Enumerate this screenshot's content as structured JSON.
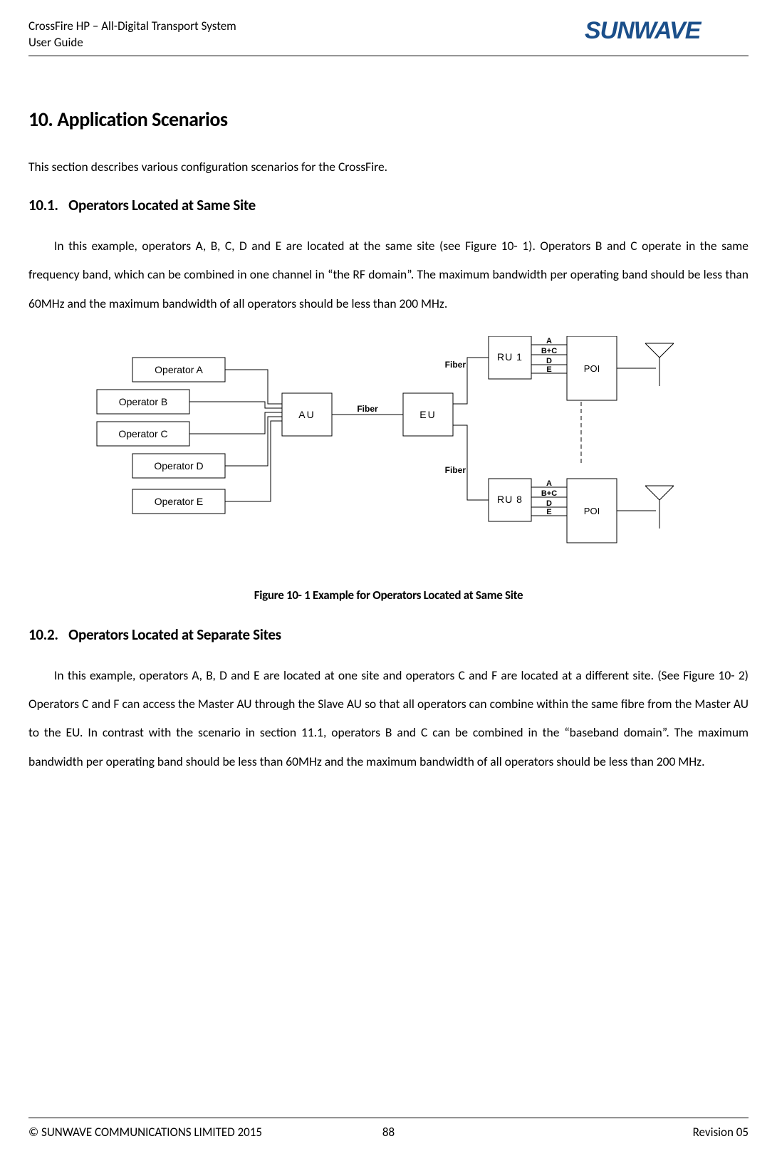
{
  "header": {
    "title_line1": "CrossFire HP – All-Digital Transport System",
    "title_line2": "User Guide",
    "logo_text": "SUNWAVE"
  },
  "section": {
    "number": "10.",
    "title": "Application Scenarios",
    "intro": "This section describes various configuration scenarios for the CrossFire."
  },
  "sub1": {
    "number": "10.1.",
    "title": "Operators Located at Same Site",
    "para": "In this example, operators A, B, C, D and E are located at the same site (see Figure 10- 1). Operators B and C operate in the same frequency band, which can be combined in one channel in “the RF domain”. The maximum bandwidth per operating band should be less than 60MHz and the maximum bandwidth of all operators should be less than 200 MHz."
  },
  "figure": {
    "caption": "Figure 10- 1 Example for Operators Located at Same Site",
    "operators": [
      "Operator A",
      "Operator B",
      "Operator C",
      "Operator D",
      "Operator E"
    ],
    "au": "AU",
    "eu": "EU",
    "fiber": "Fiber",
    "ru1": "RU 1",
    "ru8": "RU 8",
    "poi": "POI",
    "port_labels": [
      "A",
      "B+C",
      "D",
      "E"
    ]
  },
  "sub2": {
    "number": "10.2.",
    "title": "Operators Located at Separate Sites",
    "para": "In this example, operators A, B, D and E are located at one site and operators C and F are located at a different site. (See Figure 10- 2) Operators C and F can access the Master AU through the Slave AU so that all operators can combine within the same fibre from the Master AU to the EU. In contrast with the scenario in section 11.1, operators B and C can be combined in the “baseband domain”. The maximum bandwidth per operating band should be less than 60MHz and the maximum bandwidth of all operators should be less than 200 MHz."
  },
  "footer": {
    "left": "© SUNWAVE COMMUNICATIONS LIMITED 2015",
    "center": "88",
    "right": "Revision 05"
  },
  "chart_data": {
    "type": "diagram",
    "description": "Block diagram: 5 operators (A–E) feed an AU, linked by fiber to an EU. EU fans out via fiber to RU 1 through RU 8. Each RU connects to a POI (ports A, B+C, D, E) and then to an antenna.",
    "nodes": [
      {
        "id": "opA",
        "label": "Operator A"
      },
      {
        "id": "opB",
        "label": "Operator B"
      },
      {
        "id": "opC",
        "label": "Operator C"
      },
      {
        "id": "opD",
        "label": "Operator D"
      },
      {
        "id": "opE",
        "label": "Operator E"
      },
      {
        "id": "AU",
        "label": "AU"
      },
      {
        "id": "EU",
        "label": "EU"
      },
      {
        "id": "RU1",
        "label": "RU 1"
      },
      {
        "id": "RU8",
        "label": "RU 8"
      },
      {
        "id": "POI1",
        "label": "POI"
      },
      {
        "id": "POI8",
        "label": "POI"
      },
      {
        "id": "ANT1",
        "label": "Antenna"
      },
      {
        "id": "ANT8",
        "label": "Antenna"
      }
    ],
    "edges": [
      {
        "from": "opA",
        "to": "AU"
      },
      {
        "from": "opB",
        "to": "AU"
      },
      {
        "from": "opC",
        "to": "AU"
      },
      {
        "from": "opD",
        "to": "AU"
      },
      {
        "from": "opE",
        "to": "AU"
      },
      {
        "from": "AU",
        "to": "EU",
        "label": "Fiber"
      },
      {
        "from": "EU",
        "to": "RU1",
        "label": "Fiber"
      },
      {
        "from": "EU",
        "to": "RU8",
        "label": "Fiber"
      },
      {
        "from": "RU1",
        "to": "POI1",
        "ports": [
          "A",
          "B+C",
          "D",
          "E"
        ]
      },
      {
        "from": "RU8",
        "to": "POI8",
        "ports": [
          "A",
          "B+C",
          "D",
          "E"
        ]
      },
      {
        "from": "POI1",
        "to": "ANT1"
      },
      {
        "from": "POI8",
        "to": "ANT8"
      }
    ]
  }
}
